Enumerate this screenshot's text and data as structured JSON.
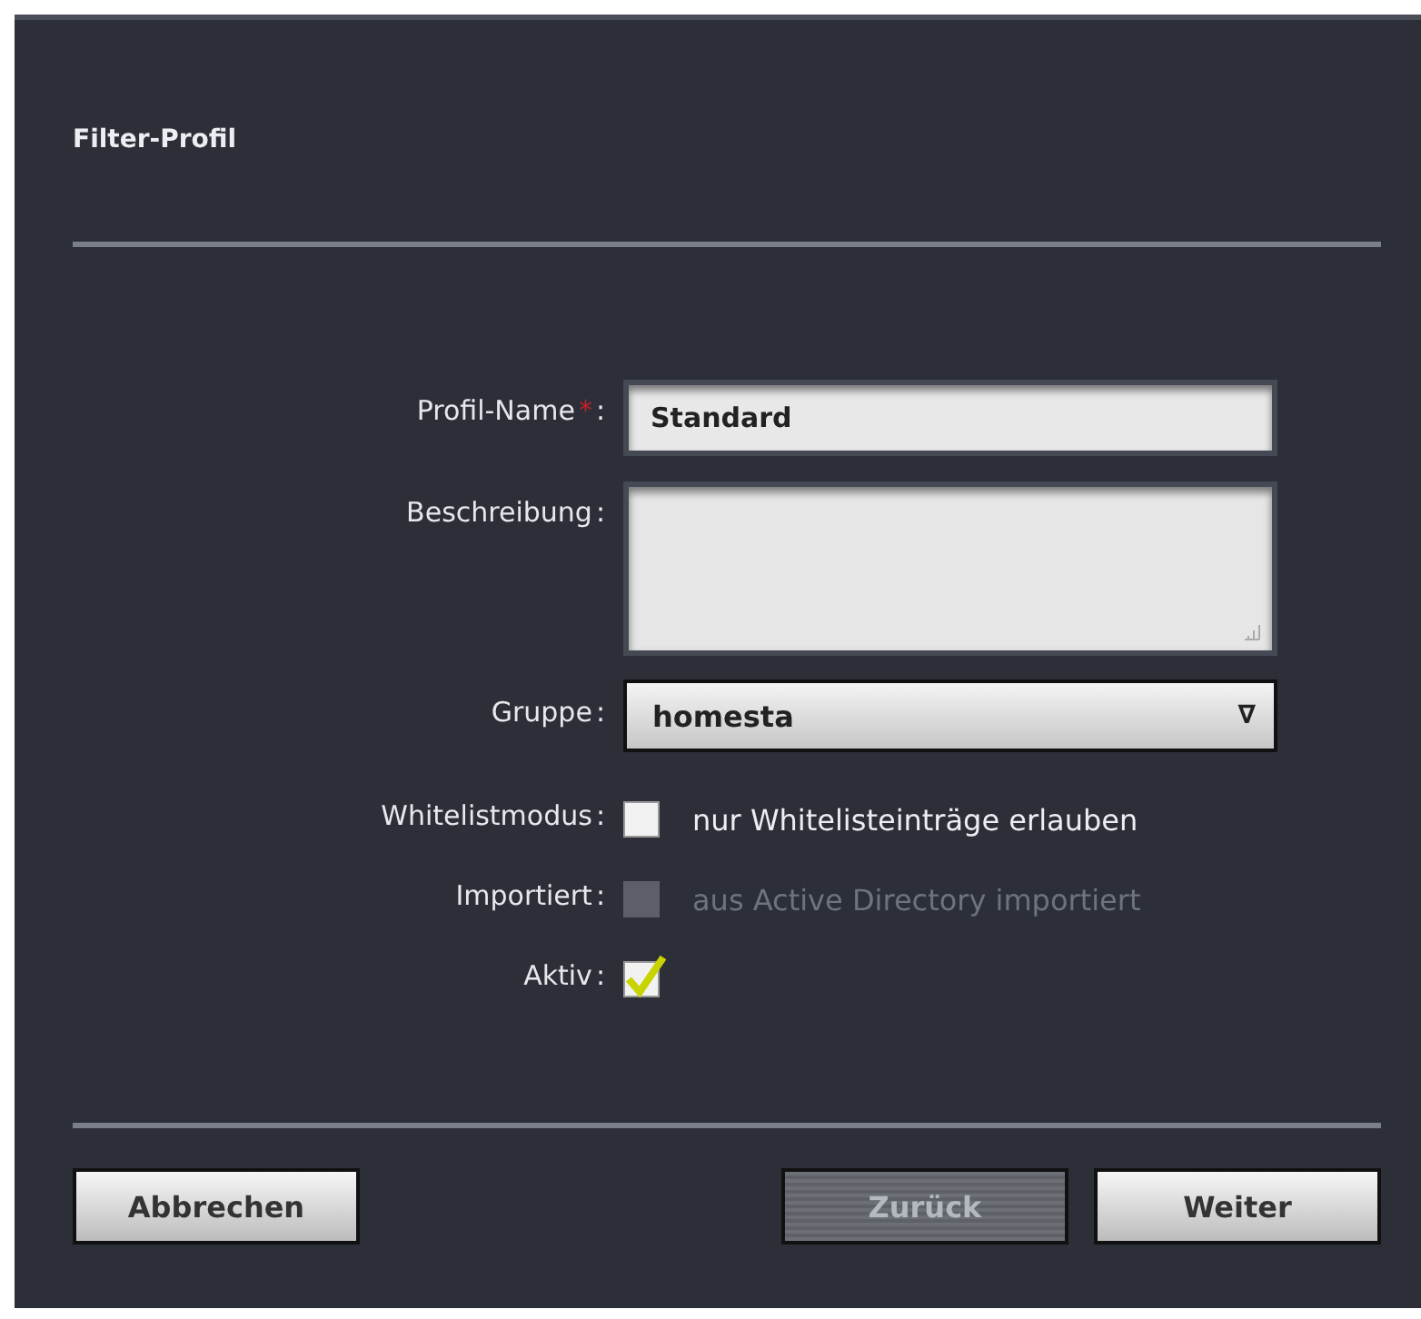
{
  "window": {
    "title": "Filter-Profil"
  },
  "fields": [
    {
      "kind": "text",
      "label": "Profil-Name",
      "required_mark": "*",
      "colon": ":",
      "value": "Standard"
    },
    {
      "kind": "textarea",
      "label": "Beschreibung",
      "colon": ":"
    },
    {
      "kind": "dropdown",
      "label": "Gruppe",
      "colon": ":",
      "value": "homesta",
      "arrow": "∇"
    },
    {
      "kind": "checkbox",
      "label": "Whitelistmodus",
      "colon": ":",
      "checked": false,
      "disabled": false,
      "text": "nur Whitelisteinträge erlauben"
    },
    {
      "kind": "checkbox",
      "label": "Importiert",
      "colon": ":",
      "checked": false,
      "disabled": true,
      "text": "aus Active Directory importiert"
    },
    {
      "kind": "checkbox",
      "label": "Aktiv",
      "colon": ":",
      "checked": true,
      "disabled": false
    }
  ],
  "buttons": [
    {
      "label": "Abbrechen",
      "disabled": false
    },
    {
      "label": "Zurück",
      "disabled": true
    },
    {
      "label": "Weiter",
      "disabled": false
    }
  ]
}
